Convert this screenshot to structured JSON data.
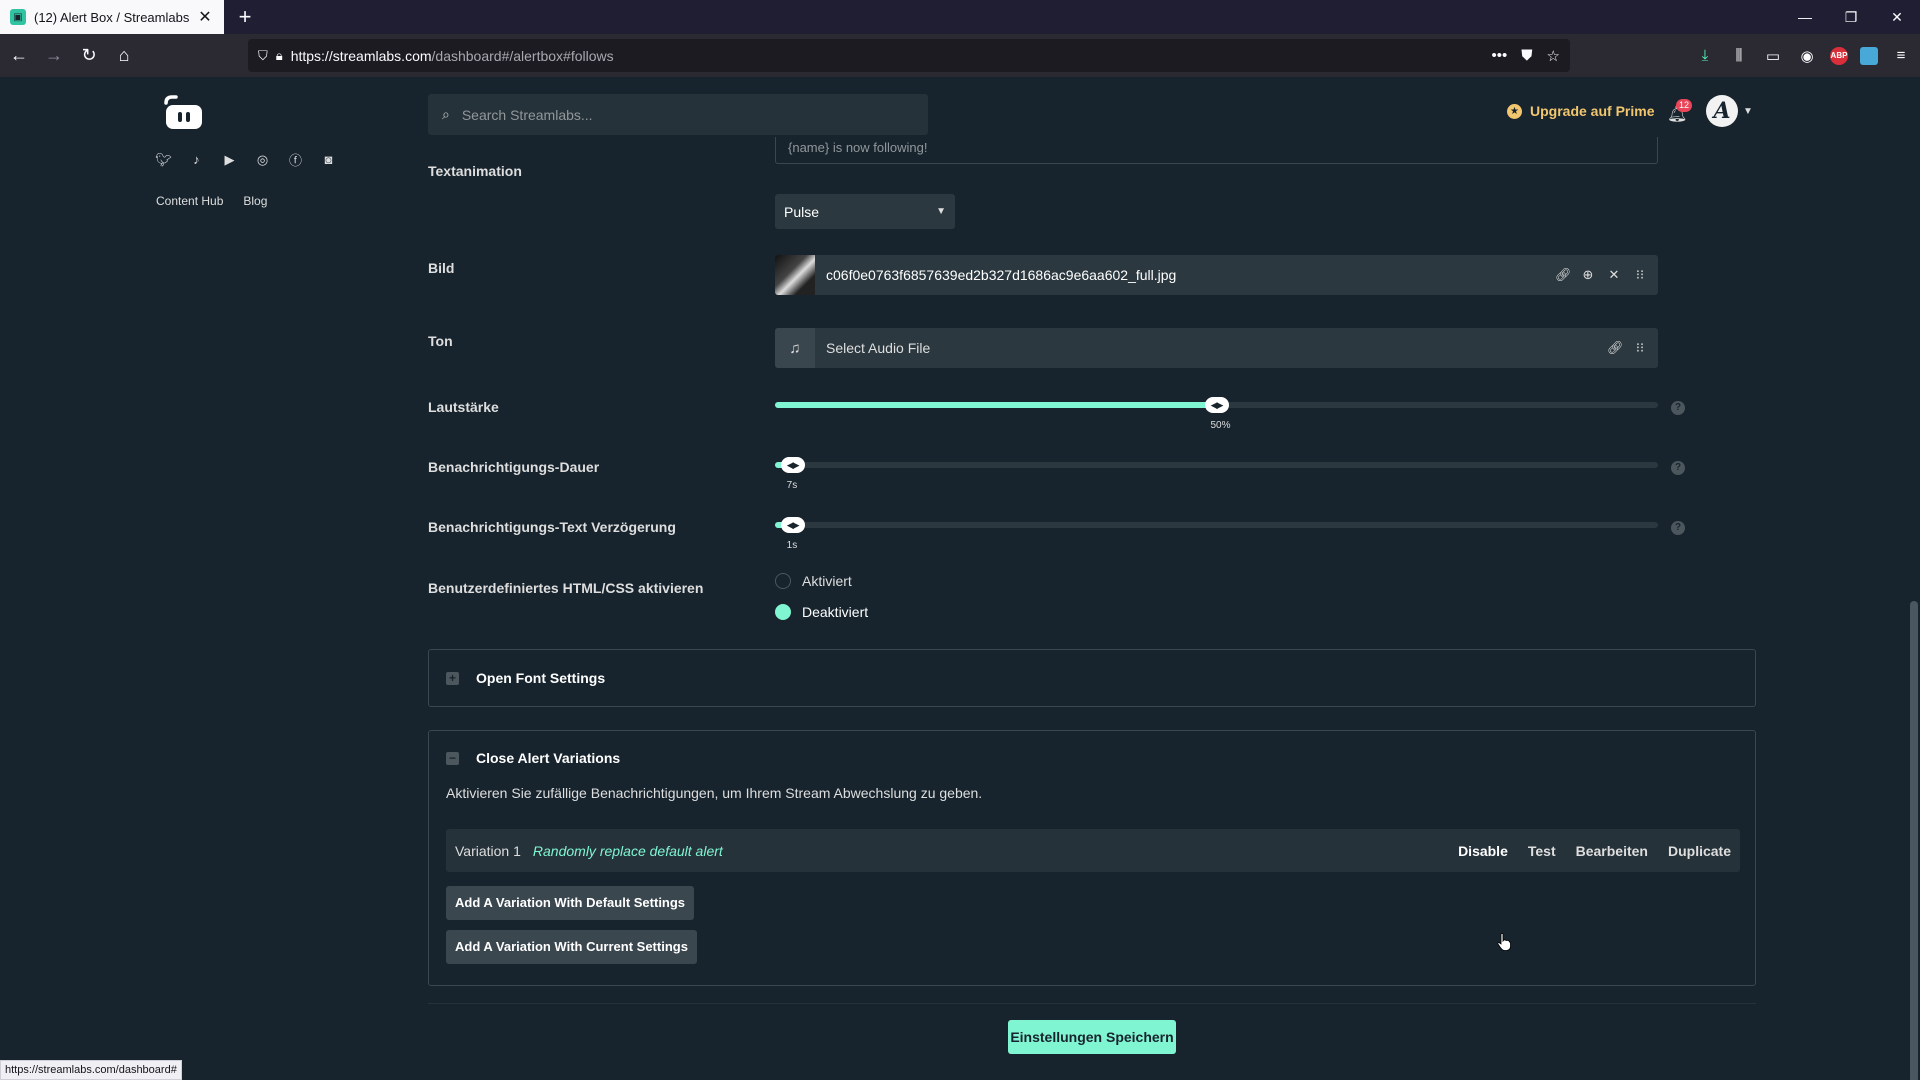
{
  "browser": {
    "tab_title": "(12) Alert Box / Streamlabs",
    "url_host": "https://streamlabs.com",
    "url_path": "/dashboard#/alertbox#follows",
    "status_url": "https://streamlabs.com/dashboard#"
  },
  "sidebar": {
    "links": [
      "Content Hub",
      "Blog"
    ],
    "social_icons": [
      "twitter-icon",
      "tiktok-icon",
      "youtube-icon",
      "instagram-icon",
      "facebook-icon",
      "discord-icon"
    ]
  },
  "header": {
    "search_placeholder": "Search Streamlabs...",
    "prime_label": "Upgrade auf Prime",
    "notification_count": "12",
    "avatar_initial": "A"
  },
  "form": {
    "top_input_value": "{name} is now following!",
    "text_animation": {
      "label": "Textanimation",
      "value": "Pulse"
    },
    "image": {
      "label": "Bild",
      "filename": "c06f0e0763f6857639ed2b327d1686ac9e6aa602_full.jpg"
    },
    "sound": {
      "label": "Ton",
      "placeholder": "Select Audio File"
    },
    "volume": {
      "label": "Lautstärke",
      "value_text": "50%",
      "value": 0.5
    },
    "duration": {
      "label": "Benachrichtigungs-Dauer",
      "value_text": "7s",
      "value": 0.02
    },
    "text_delay": {
      "label": "Benachrichtigungs-Text Verzögerung",
      "value_text": "1s",
      "value": 0.02
    },
    "custom_html": {
      "label": "Benutzerdefiniertes HTML/CSS aktivieren",
      "options": [
        "Aktiviert",
        "Deaktiviert"
      ],
      "selected": "Deaktiviert"
    }
  },
  "font_panel": {
    "label": "Open Font Settings"
  },
  "variations_panel": {
    "label": "Close Alert Variations",
    "description": "Aktivieren Sie zufällige Benachrichtigungen, um Ihrem Stream Abwechslung zu geben.",
    "variation": {
      "name": "Variation 1",
      "description": "Randomly replace default alert",
      "actions": [
        "Disable",
        "Test",
        "Bearbeiten",
        "Duplicate"
      ]
    },
    "add_default_label": "Add A Variation With Default Settings",
    "add_current_label": "Add A Variation With Current Settings"
  },
  "save_label": "Einstellungen Speichern",
  "colors": {
    "accent": "#80f5d2",
    "background": "#17242d",
    "prime": "#f2c66e"
  }
}
